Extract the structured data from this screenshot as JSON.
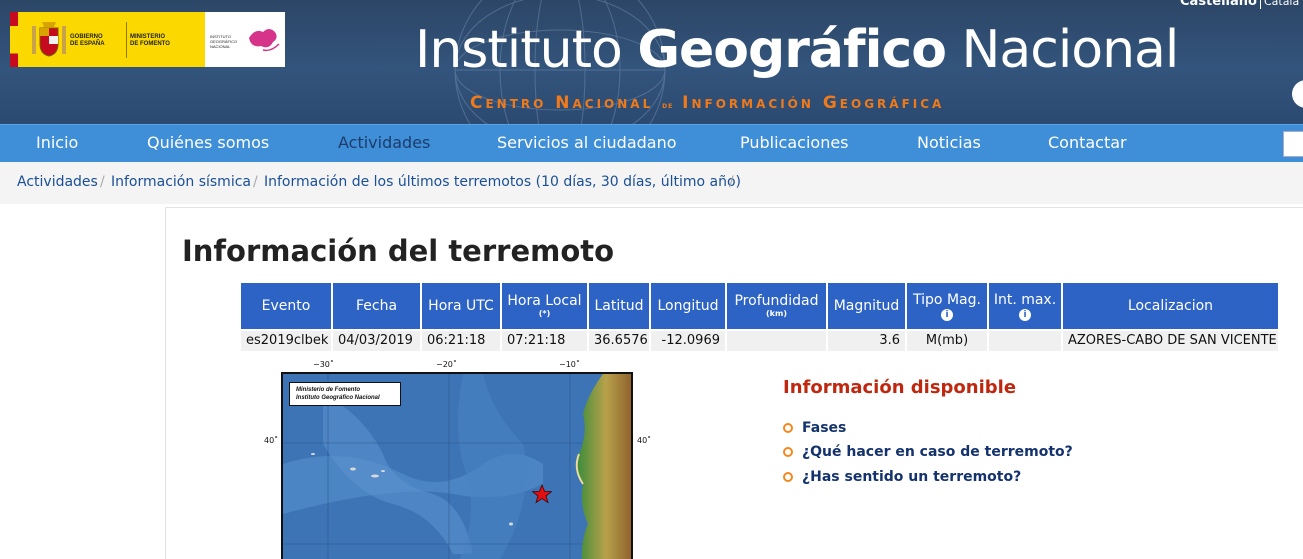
{
  "header": {
    "gov_text_1": "GOBIERNO\nDE ESPAÑA",
    "gov_text_2": "MINISTERIO\nDE FOMENTO",
    "gov_text_3": "INSTITUTO\nGEOGRÁFICO\nNACIONAL",
    "title_light_1": "Instituto ",
    "title_bold": "Geográfico",
    "title_light_2": " Nacional",
    "subtitle_1": "Centro Nacional ",
    "subtitle_de": "de",
    "subtitle_2": " Información Geográfica",
    "lang_current": "Castellano",
    "lang_other": "Català"
  },
  "nav": {
    "items": [
      "Inicio",
      "Quiénes somos",
      "Actividades",
      "Servicios al ciudadano",
      "Publicaciones",
      "Noticias",
      "Contactar"
    ],
    "active": "Actividades"
  },
  "breadcrumb": [
    "Actividades",
    "Información sísmica",
    "Información de los últimos terremotos (10 días, 30 días, último año)"
  ],
  "page_title": "Información del terremoto",
  "table": {
    "headers": [
      {
        "label": "Evento"
      },
      {
        "label": "Fecha"
      },
      {
        "label": "Hora UTC"
      },
      {
        "label": "Hora Local",
        "sub": "(*)"
      },
      {
        "label": "Latitud"
      },
      {
        "label": "Longitud"
      },
      {
        "label": "Profundidad",
        "sub": "(km)"
      },
      {
        "label": "Magnitud"
      },
      {
        "label": "Tipo Mag.",
        "info": "i"
      },
      {
        "label": "Int. max.",
        "info": "i"
      },
      {
        "label": "Localizacion"
      }
    ],
    "row": [
      "es2019clbek",
      "04/03/2019",
      "06:21:18",
      "07:21:18",
      "36.6576",
      "-12.0969",
      "",
      "3.6",
      "M(mb)",
      "",
      "AZORES-CABO DE SAN VICENTE"
    ]
  },
  "map": {
    "legend_line_1": "Ministerio de Fomento",
    "legend_line_2": "Instituto Geográfico Nacional",
    "top_labels": [
      "−30˚",
      "−20˚",
      "−10˚"
    ],
    "left_label": "40˚",
    "right_label": "40˚",
    "marker": "star-marker"
  },
  "info": {
    "title": "Información disponible",
    "items": [
      "Fases",
      "¿Qué hacer en caso de terremoto?",
      "¿Has sentido un terremoto?"
    ]
  },
  "colors": {
    "header_bg": "#2c4666",
    "nav_bg": "#3e8ed8",
    "table_header": "#2d63c4",
    "accent_orange": "#f07a1a",
    "info_title": "#c0270f",
    "link_dark": "#14336e"
  }
}
